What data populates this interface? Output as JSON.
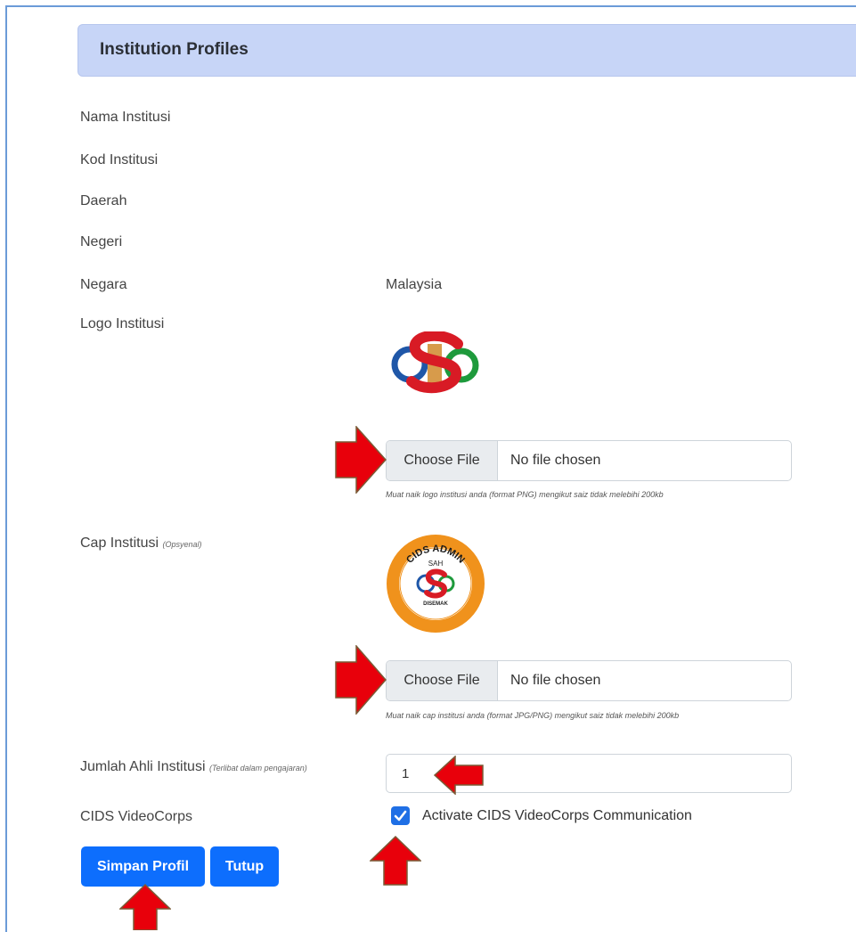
{
  "header": {
    "title": "Institution Profiles"
  },
  "fields": {
    "nama_label": "Nama Institusi",
    "kod_label": "Kod Institusi",
    "daerah_label": "Daerah",
    "negeri_label": "Negeri",
    "negara_label": "Negara",
    "negara_value": "Malaysia",
    "logo_label": "Logo Institusi",
    "cap_label": "Cap Institusi",
    "cap_optional": "(Opsyenal)",
    "jumlah_label": "Jumlah Ahli Institusi",
    "jumlah_note": "(Terlibat dalam pengajaran)",
    "jumlah_value": "1",
    "videocorps_label": "CIDS VideoCorps"
  },
  "logo_upload": {
    "button": "Choose File",
    "status": "No file chosen",
    "help": "Muat naik logo institusi anda (format PNG) mengikut saiz tidak melebihi 200kb"
  },
  "cap_upload": {
    "button": "Choose File",
    "status": "No file chosen",
    "help": "Muat naik cap institusi anda (format JPG/PNG) mengikut saiz tidak melebihi 200kb"
  },
  "stamp": {
    "top_text": "CIDS ADMIN",
    "mid_text": "SAH",
    "bottom_text": "DISEMAK"
  },
  "videocorps": {
    "checked": true,
    "label": "Activate CIDS VideoCorps Communication"
  },
  "buttons": {
    "save": "Simpan Profil",
    "close": "Tutup"
  },
  "colors": {
    "primary": "#0d6efd",
    "header_bg": "#c7d5f7",
    "arrow": "#e8000b",
    "stamp_ring": "#f0921c"
  }
}
